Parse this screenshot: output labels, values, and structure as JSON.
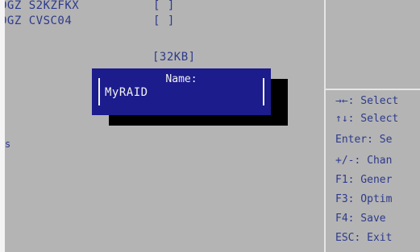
{
  "disk_rows": [
    {
      "id": "drive-row-1",
      "text": "0GZ S2KZFKX",
      "bracket": "[ ]"
    },
    {
      "id": "drive-row-2",
      "text": "0GZ CVSC04",
      "bracket": "[ ]"
    }
  ],
  "size_field": "[32KB]",
  "left_edge_fragment": "s",
  "dialog": {
    "title": "Name:",
    "value": "MyRAID"
  },
  "help": {
    "select_screen": "→←: Select",
    "select_item": "↑↓: Select",
    "enter": "Enter: Se",
    "change": "+/-: Chan",
    "f1": "F1: Gener",
    "f3": "F3: Optim",
    "f4": "F4: Save",
    "esc": "ESC: Exit"
  }
}
